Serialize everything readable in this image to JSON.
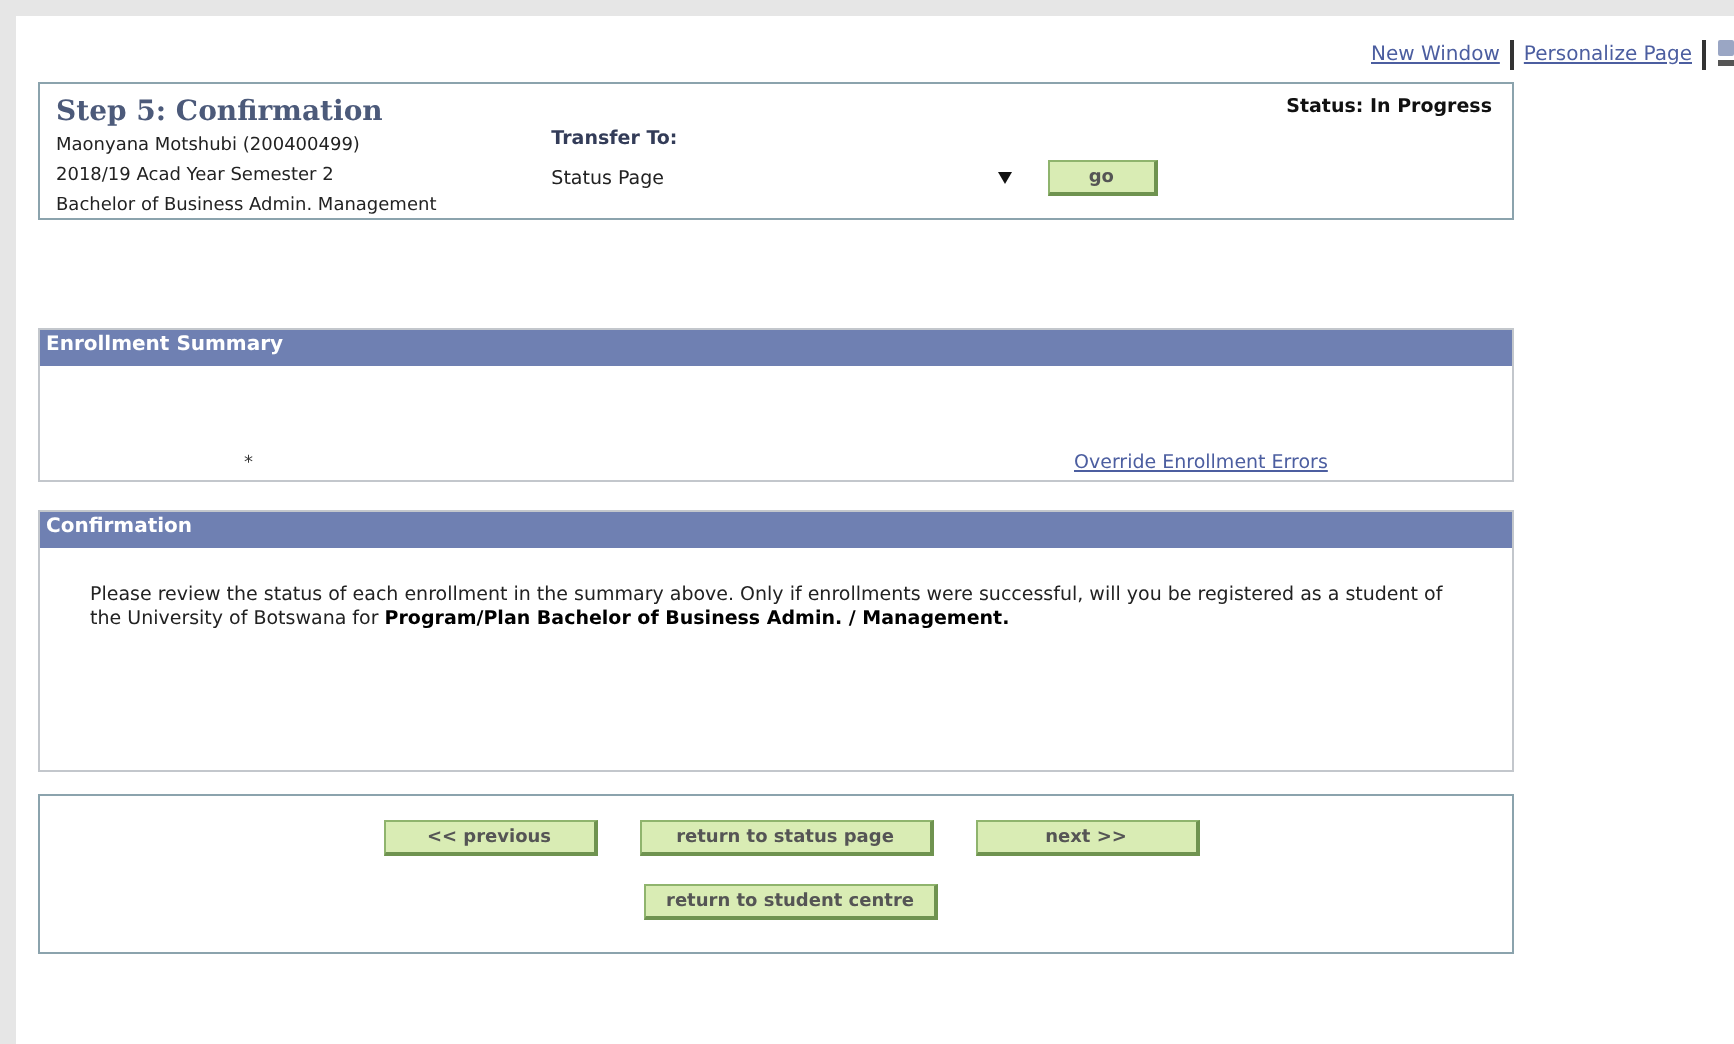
{
  "top_links": [
    "New Window",
    "Personalize Page"
  ],
  "header": {
    "title": "Step 5: Confirmation",
    "status": "Status: In Progress",
    "student_lines": [
      "Maonyana Motshubi (200400499)",
      "2018/19 Acad Year Semester 2",
      "Bachelor of Business Admin. Management"
    ],
    "transfer_label": "Transfer To:",
    "transfer_value": "Status Page",
    "go_button": "go"
  },
  "enrollment_summary": {
    "title": "Enrollment Summary",
    "marker": "*",
    "link": "Override Enrollment Errors"
  },
  "confirmation": {
    "title": "Confirmation",
    "message": "Please review the status of each enrollment in the summary above. Only if enrollments were successful, will you be registered as a student of the University of Botswana for **Program/Plan Bachelor of Business Admin. / Management.**"
  },
  "buttons": [
    [
      "<< previous",
      "return to status page",
      "next >>"
    ],
    [
      "return to student centre"
    ]
  ]
}
